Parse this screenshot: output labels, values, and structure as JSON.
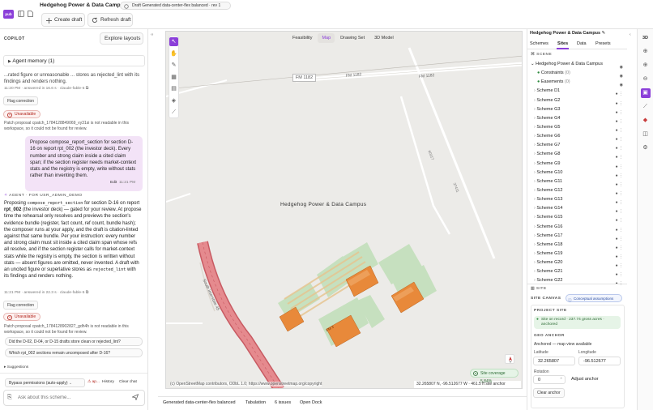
{
  "app": {
    "logo": "pub",
    "title": "Hedgehog Power & Data Campus",
    "draft_pill": "Draft Generated data-center-flex balanced · rev 1",
    "create_draft": "Create draft",
    "refresh_draft": "Refresh draft"
  },
  "copilot": {
    "header": "COPILOT",
    "explore_layouts": "Explore layouts",
    "agent_memory": "Agent memory (1)",
    "msg1_partial": "...rated figure or unreasonable ... stores as rejected_lint with its findings and renders nothing.",
    "msg1_meta": "11:20 PM · answered in 16.6 s · claude-fable-5",
    "flag1": "Flag correction",
    "unavailable1": "Unavailable",
    "patch1": "Patch proposal cpatch_1784128849069_vy31si is not readable in this workspace, so it could not be found for review.",
    "user_msg": "Propose compose_report_section for section D-16 on report rpt_002 (the investor deck). Every number and strong claim inside a cited claim span; if the section register needs market-context stats and the registry is empty, write without stats rather than inventing them.",
    "edit": "Edit",
    "user_time": "11:21 PM",
    "agent_label": "AGENT · FOR USR_ADMIN_DEMO",
    "proposing": "Proposing",
    "proposing_code": "compose_report_section",
    "proposing_rest": "for section D-16 on report",
    "report_id": "rpt_002",
    "agent_body": "(the investor deck) — gated for your review. At propose time the rehearsal only resolves and previews the section's evidence bundle (register, fact count, ref count, bundle hash); the composer runs at your apply, and the draft is citation-linted against that same bundle. Per your instruction: every number and strong claim must sit inside a cited claim span whose refs all resolve, and if the section register calls for market-context stats while the registry is empty, the section is written without stats — absent figures are omitted, never invented. A draft with an uncited figure or superlative stores as",
    "rejected_code": "rejected_lint",
    "agent_tail": "with its findings and renders nothing.",
    "msg2_meta": "11:21 PM · answered in 22.3 s · claude-fable-5",
    "flag2": "Flag correction",
    "unavailable2": "Unavailable",
    "patch2": "Patch proposal cpatch_1784128902827_gdh4h is not readable in this workspace, so it could not be found for review.",
    "suggest1": "Did the D-02, D-04, or D-15 drafts store clean or rejected_lint?",
    "suggest2": "Which rpt_002 sections remain uncomposed after D-16?",
    "suggestions": "Suggestions",
    "bypass": "Bypass permissions (auto-apply)",
    "ap": "ap...",
    "history": "History",
    "clear_chat": "Clear chat",
    "ask_placeholder": "Ask about this scheme..."
  },
  "map": {
    "tabs": [
      "Feasibility",
      "Map",
      "Drawing Set",
      "3D Model"
    ],
    "active_tab": "Map",
    "road_label_1": "FM 1182",
    "road_label_2": "FM 1182",
    "road_label_3": "FM 1182",
    "road_small_1": "6011?",
    "road_small_2": "3?411",
    "road_south": "South Interstate 45",
    "campus_label": "Hedgehog Power & Data Campus",
    "fm_small": "FM 3",
    "attribution": "(c) OpenStreetMap contributors, ODbL 1.0; https://www.openstreetmap.org/copyright",
    "coords": "32.265807 N, -96.512677 W · 461.5 ft site anchor",
    "coverage": "Site coverage 5.84%"
  },
  "right": {
    "title": "Hedgehog Power & Data Campus",
    "tabs": [
      "Schemes",
      "Sites",
      "Data",
      "Presets"
    ],
    "active_tab": "Sites",
    "scene_header": "SCENE",
    "scene_root": "Hedgehog Power & Data Campus",
    "constraints": "Constraints",
    "constraints_count": "(0)",
    "easements": "Easements",
    "easements_count": "(0)",
    "schemes": [
      "Scheme D1",
      "Scheme G2",
      "Scheme G3",
      "Scheme G4",
      "Scheme G5",
      "Scheme G6",
      "Scheme G7",
      "Scheme G8",
      "Scheme G9",
      "Scheme G10",
      "Scheme G11",
      "Scheme G12",
      "Scheme G13",
      "Scheme G14",
      "Scheme G15",
      "Scheme G16",
      "Scheme G17",
      "Scheme G18",
      "Scheme G19",
      "Scheme G20",
      "Scheme G21",
      "Scheme G22"
    ],
    "site_header": "SITE",
    "site_canvas": "SITE CANVAS",
    "conceptual": "Conceptual assumptions",
    "project_site": "PROJECT SITE",
    "site_record": "Site on record · 237.74 gross acres · anchored",
    "geo_anchor": "GEO ANCHOR",
    "anchored_note": "Anchored — map view available",
    "lat_label": "Latitude",
    "lat": "32.265807",
    "lon_label": "Longitude",
    "lon": "-96.512677",
    "rot_label": "Rotation",
    "rot": "0",
    "adjust_anchor": "Adjust anchor",
    "clear_anchor": "Clear anchor",
    "view3d": "3D"
  },
  "bottom": {
    "tabs": [
      "Generated data-center-flex balanced",
      "Tabulation",
      "6 issues",
      "Open Dock"
    ]
  },
  "colors": {
    "accent": "#8b3fd9",
    "road": "#e58a8e",
    "road_edge": "#c85a62",
    "building": "#e8893a",
    "pad": "#c5e0bd",
    "map_bg": "#ecebe8",
    "coverage_bg": "#e6f4e7"
  }
}
